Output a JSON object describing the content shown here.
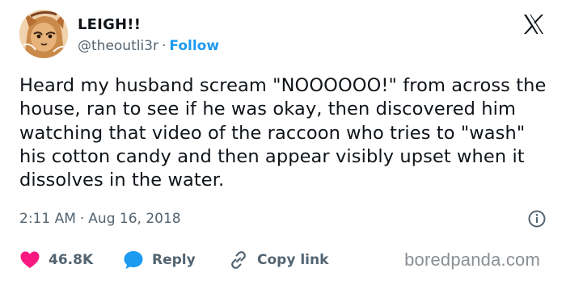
{
  "user": {
    "display_name": "LEIGH!!",
    "handle": "@theoutli3r",
    "separator": "·",
    "follow_label": "Follow"
  },
  "tweet": {
    "text": "Heard my husband scream \"NOOOOOO!\" from across the house, ran to see if he was okay, then discovered him watching that video of the raccoon who tries to \"wash\" his cotton candy and then appear visibly upset when it dissolves in the water.",
    "time": "2:11 AM",
    "separator": "·",
    "date": "Aug 16, 2018"
  },
  "actions": {
    "likes_count": "46.8K",
    "reply_label": "Reply",
    "copy_link_label": "Copy link"
  },
  "watermark": "boredpanda.com",
  "colors": {
    "accent": "#1d9bf0",
    "heart": "#f91880",
    "text": "#0f1419",
    "muted": "#536471"
  },
  "icons": [
    "avatar-illustration",
    "x-logo-icon",
    "info-icon",
    "heart-icon",
    "reply-bubble-icon",
    "link-icon"
  ]
}
